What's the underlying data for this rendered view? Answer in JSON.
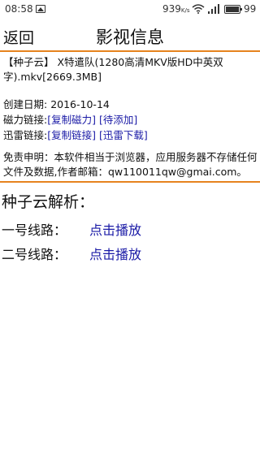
{
  "status_bar": {
    "time": "08:58",
    "speed": "939",
    "speed_unit": "K/s",
    "battery": "99",
    "icons": [
      "image-icon",
      "wifi-icon",
      "signal-icon",
      "battery-icon"
    ]
  },
  "header": {
    "back_label": "返回",
    "title": "影视信息"
  },
  "info": {
    "name": "【种子云】 X特遣队(1280高清MKV版HD中英双字).mkv[2669.3MB]",
    "created_label": "创建日期:",
    "created_value": "2016-10-14",
    "magnet_label": "磁力链接:",
    "magnet_copy": "[复制磁力]",
    "magnet_pending": "[待添加]",
    "thunder_label": "迅雷链接:",
    "thunder_copy": "[复制链接]",
    "thunder_download": "[迅雷下载]",
    "disclaimer": "免责申明：本软件相当于浏览器，应用服务器不存储任何文件及数据,作者邮箱：qw110011qw@gmai.com。"
  },
  "parse": {
    "title": "种子云解析：",
    "lines": [
      {
        "label": "一号线路：",
        "action": "点击播放"
      },
      {
        "label": "二号线路：",
        "action": "点击播放"
      }
    ]
  },
  "colors": {
    "accent": "#e6831e",
    "link": "#1a1aa6"
  }
}
